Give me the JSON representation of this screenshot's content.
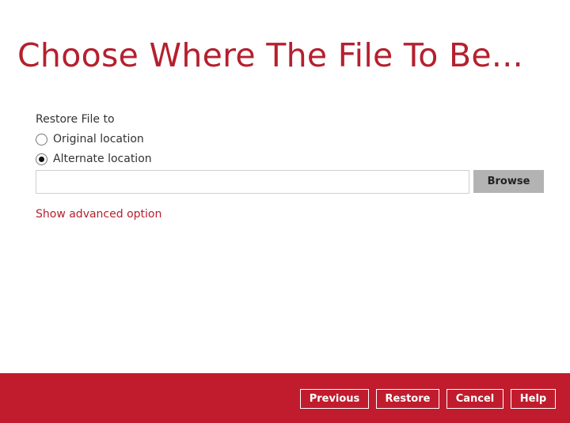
{
  "page": {
    "title": "Choose Where The File To Be..."
  },
  "restore": {
    "section_label": "Restore File to",
    "options": [
      {
        "label": "Original location",
        "selected": false
      },
      {
        "label": "Alternate location",
        "selected": true
      }
    ],
    "path_value": "",
    "path_placeholder": "",
    "browse_label": "Browse",
    "advanced_link": "Show advanced option"
  },
  "footer": {
    "previous_label": "Previous",
    "restore_label": "Restore",
    "cancel_label": "Cancel",
    "help_label": "Help"
  },
  "colors": {
    "accent": "#b5202e",
    "footer_bg": "#c01c2d",
    "browse_bg": "#b3b3b3"
  }
}
